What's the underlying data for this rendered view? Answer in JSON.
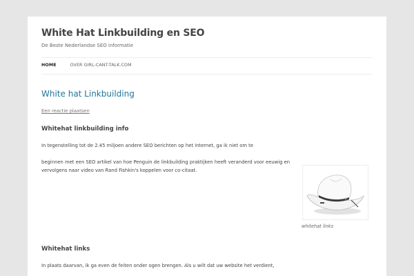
{
  "site": {
    "title": "White Hat Linkbuilding en SEO",
    "description": "De Beste Nederlandse SEO informatie"
  },
  "nav": {
    "items": [
      {
        "label": "HOME"
      },
      {
        "label": "OVER GIRL-CANT-TALK.COM"
      }
    ]
  },
  "article": {
    "title": "White hat Linkbuilding",
    "reply_link": "Een reactie plaatsen",
    "heading1": "Whitehat linkbuilding info",
    "para1": "In tegenstelling tot de 2.45 miljoen andere SEO berichten op het internet, ga ik niet om te",
    "para2_line1": "beginnen met een SEO artikel van hoe Penguin de linkbuilding praktijken heeft veranderd voor eeuwig en",
    "para2_line2": "vervolgens naar video van Rand Fishkin's koppelen voor co-citaat.",
    "heading2": "Whitehat links",
    "para3": "In plaats daarvan, ik ga even de feiten onder ogen brengen. Als u wilt dat uw website het verdient,"
  },
  "figure": {
    "caption": "whitehat links",
    "icon": "cowboy-hat-image"
  }
}
